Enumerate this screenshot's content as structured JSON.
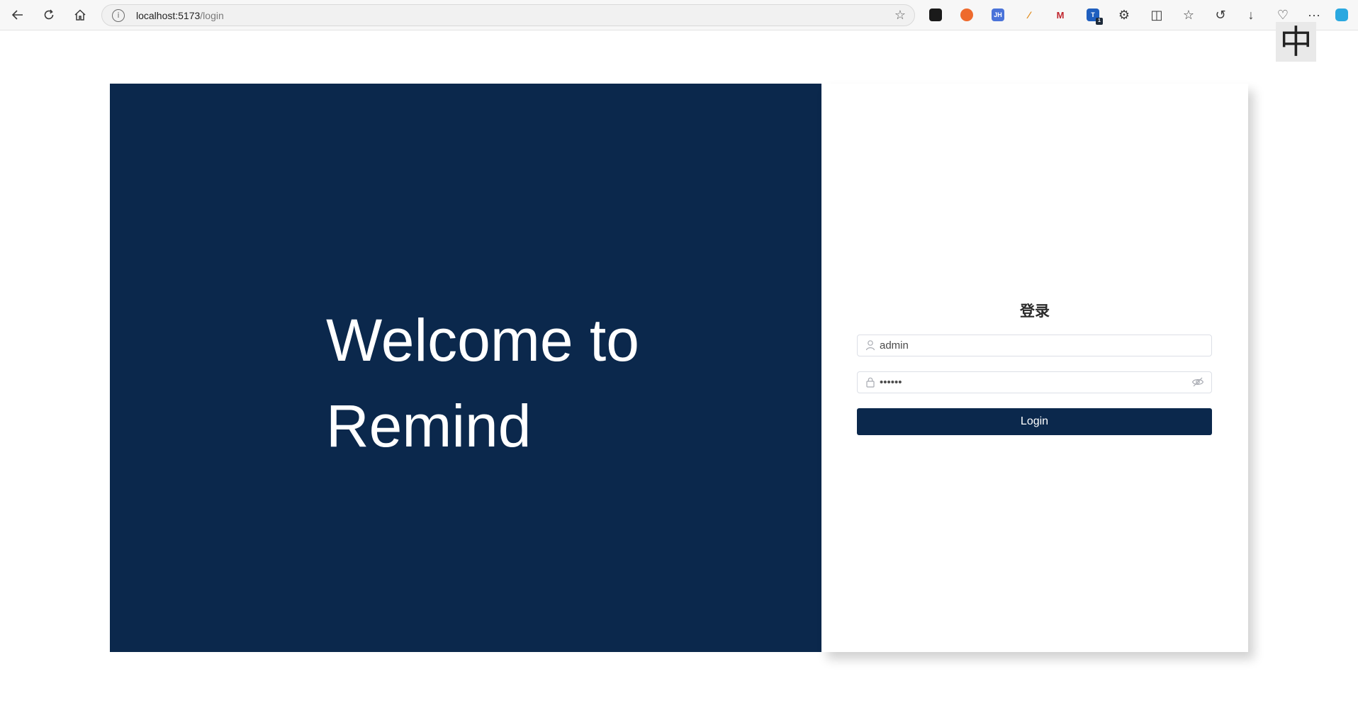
{
  "browser": {
    "url_host": "localhost:5173",
    "url_path": "/login",
    "back_icon": "arrow-left-icon",
    "refresh_icon": "refresh-icon",
    "home_icon": "home-icon",
    "favorite_icon": "star-icon",
    "menu_label": "···",
    "extension_jh_label": "JH",
    "extension_badge_count": "1"
  },
  "ime_indicator": "中",
  "hero": {
    "title_line1": "Welcome to",
    "title_line2": "Remind"
  },
  "login": {
    "title": "登录",
    "username_value": "admin",
    "password_value": "••••••",
    "button_label": "Login"
  },
  "colors": {
    "brand_navy": "#0b284c"
  }
}
